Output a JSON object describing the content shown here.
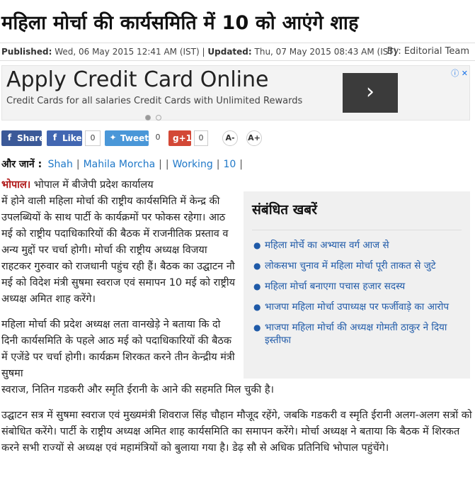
{
  "article": {
    "title": "महिला मोर्चा की कार्यसमिति में 10 को आएंगे शाह",
    "meta": {
      "published_label": "Published:",
      "published_value": "Wed, 06 May 2015 12:41 AM (IST)",
      "separator": "|",
      "updated_label": "Updated:",
      "updated_value": "Thu, 07 May 2015 08:43 AM (IST)",
      "by_label": "By:",
      "author": "Editorial Team"
    },
    "lead_word": "भोपाल।",
    "lead_rest": " भोपाल में बीजेपी प्रदेश कार्यालय",
    "para1": "में होने वाली महिला मोर्चा की राष्ट्रीय कार्यसमिति में केन्द्र की उपलब्धियों के साथ पार्टी के कार्यक्रमों पर फोकस रहेगा। आठ मई को राष्ट्रीय पदाधिकारियों की बैठक में राजनीतिक प्रस्ताव व अन्य मुद्दों पर चर्चा होगी। मोर्चा की राष्ट्रीय अध्यक्ष विजया राहटकर गुरुवार को राजधानी पहुंच रही हैं। बैठक का उद्घाटन नौ मई को विदेश मंत्री सुषमा स्वराज एवं समापन 10 मई को राष्ट्रीय अध्यक्ष अमित शाह करेंगे।",
    "para2": "महिला मोर्चा की प्रदेश अध्यक्ष लता वानखेड़े ने बताया कि दो दिनी कार्यसमिति के पहले आठ मई को पदाधिकारियों की बैठक में एजेंडे पर चर्चा होगी। कार्यक्रम शिरकत करने तीन केन्द्रीय मंत्री सुषमा",
    "para2_end": "स्वराज, नितिन गडकरी और स्मृति ईरानी के आने की सहमति मिल चुकी है।",
    "para3": "उद्घाटन सत्र में सुषमा स्वराज एवं मुख्यमंत्री शिवराज सिंह चौहान मौजूद रहेंगे, जबकि गडकरी व स्मृति ईरानी अलग-अलग सत्रों को संबोधित करेंगे। पार्टी के राष्ट्रीय अध्यक्ष अमित शाह कार्यसमिति का समापन करेंगे। मोर्चा अध्यक्ष ने बताया कि बैठक में शिरकत करने सभी राज्यों से अध्यक्ष एवं महामंत्रियों को बुलाया गया है। डेढ़ सौ से अधिक प्रतिनिधि भोपाल पहुंचेंगे।"
  },
  "ad": {
    "title": "Apply Credit Card Online",
    "subtitle": "Credit Cards for all salaries Credit Cards with Unlimited Rewards",
    "cta_glyph": "›",
    "info_glyph": "ⓘ ✕"
  },
  "share": {
    "fb_share": "Share",
    "fb_like": "Like",
    "like_count": "0",
    "tweet": "Tweet",
    "tweet_count": "0",
    "gplus": "g+1",
    "gplus_count": "0",
    "font_minus": "A-",
    "font_plus": "A+"
  },
  "tags": {
    "label": "और जानें :",
    "items": [
      "Shah",
      "Mahila Morcha",
      "",
      "Working",
      "10"
    ]
  },
  "related": {
    "heading": "संबंधित खबरें",
    "items": [
      "महिला मोर्चे का अभ्यास वर्ग आज से",
      "लोकसभा चुनाव में महिला मोर्चा पूरी ताकत से जुटे",
      "महिला मोर्चा बनाएगा पचास हजार सदस्य",
      "भाजपा महिला मोर्चा उपाध्यक्ष पर फर्जीवाड़े का आरोप",
      "भाजपा महिला मोर्चा की अध्यक्ष गोमती ठाकुर ने दिया इस्तीफा"
    ]
  }
}
